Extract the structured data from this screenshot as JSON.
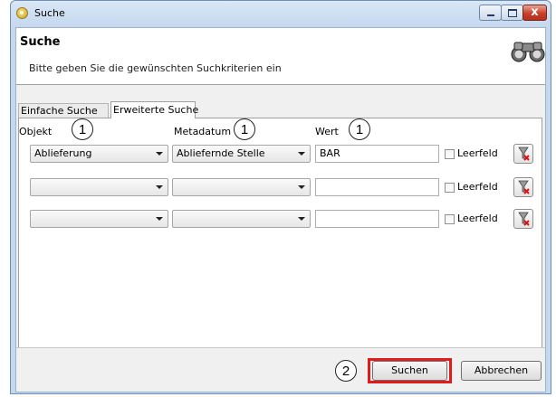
{
  "window": {
    "title": "Suche",
    "close_glyph": "x",
    "icons": [
      "app-icon",
      "minimize-icon",
      "maximize-icon",
      "close-icon"
    ]
  },
  "header": {
    "title": "Suche",
    "subtitle": "Bitte geben Sie die gewünschten Suchkriterien ein",
    "icon": "binoculars-icon"
  },
  "tabs": [
    {
      "label": "Einfache Suche",
      "active": false
    },
    {
      "label": "Erweiterte Suche",
      "active": true
    }
  ],
  "columns": {
    "object": "Objekt",
    "metadatum": "Metadatum",
    "value": "Wert"
  },
  "callouts": [
    "1",
    "1",
    "1",
    "2"
  ],
  "rows": [
    {
      "object": "Ablieferung",
      "metadatum": "Abliefernde Stelle",
      "value": "BAR",
      "empty_label": "Leerfeld",
      "empty_checked": false
    },
    {
      "object": "",
      "metadatum": "",
      "value": "",
      "empty_label": "Leerfeld",
      "empty_checked": false
    },
    {
      "object": "",
      "metadatum": "",
      "value": "",
      "empty_label": "Leerfeld",
      "empty_checked": false
    }
  ],
  "row_clear_icon": "clear-filter-icon",
  "footer": {
    "search_label": "Suchen",
    "cancel_label": "Abbrechen"
  },
  "colors": {
    "highlight": "#e01b1b",
    "title_bar": "#c5d8ee",
    "close_button": "#c8402a"
  }
}
